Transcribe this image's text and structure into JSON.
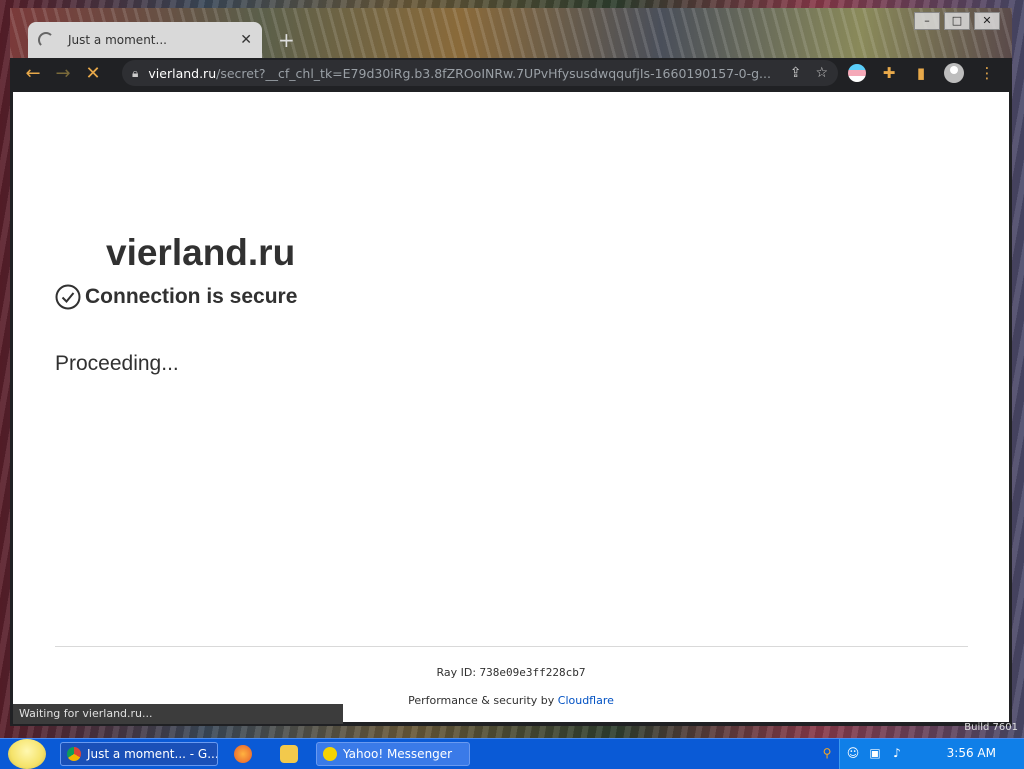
{
  "browser": {
    "tab": {
      "title": "Just a moment...",
      "close": "✕"
    },
    "new_tab": "+",
    "window_buttons": {
      "minimize": "–",
      "maximize": "□",
      "close": "✕"
    },
    "url": {
      "host": "vierland.ru",
      "path": "/secret?__cf_chl_tk=E79d30iRg.b3.8fZROoINRw.7UPvHfysusdwqqufjIs-1660190157-0-g..."
    },
    "toolbar_icons": [
      "back-icon",
      "forward-icon",
      "stop-loading-icon",
      "lock-icon",
      "share-icon",
      "bookmark-star-icon",
      "extension-profile-icon",
      "puzzle-extensions-icon",
      "side-panel-icon",
      "account-icon",
      "menu-dots-icon"
    ]
  },
  "page": {
    "site_name": "vierland.ru",
    "secure_text": "Connection is secure",
    "status_text": "Proceeding...",
    "ray_label": "Ray ID: ",
    "ray_id": "738e09e3ff228cb7",
    "perf_prefix": "Performance & security by ",
    "perf_link": "Cloudflare"
  },
  "statusbar": {
    "text": "Waiting for vierland.ru..."
  },
  "desktop": {
    "build_text": "Build 7601"
  },
  "taskbar": {
    "items": [
      {
        "label": "Just a moment... - G..."
      },
      {
        "label": "Yahoo! Messenger"
      }
    ],
    "clock": "3:56 AM"
  }
}
